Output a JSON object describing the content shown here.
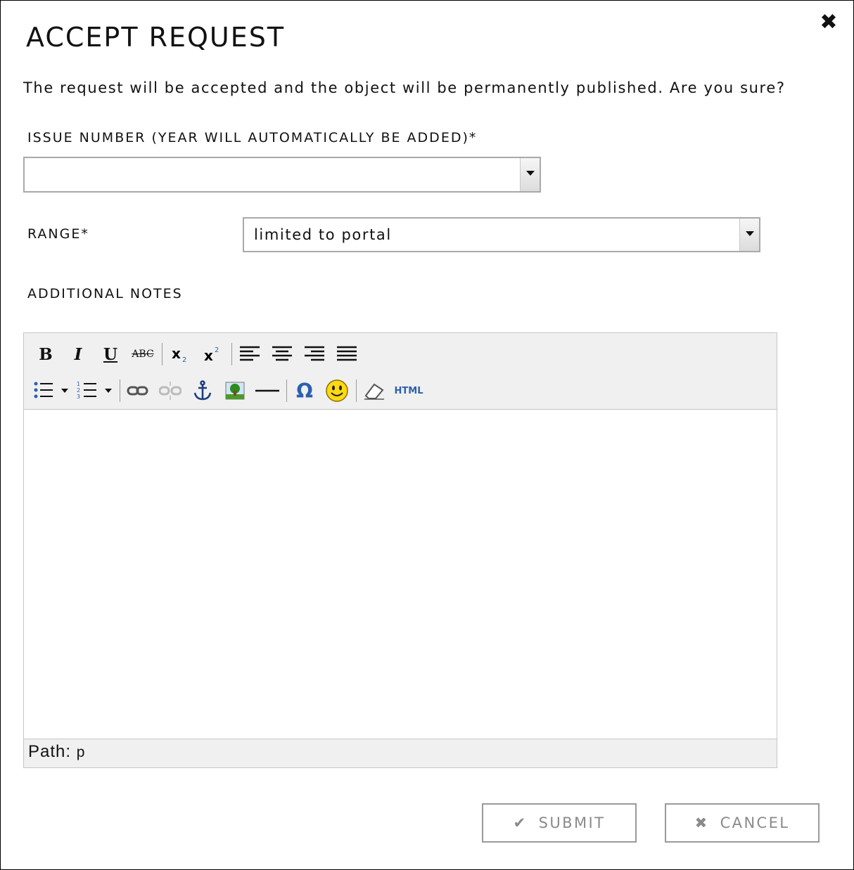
{
  "dialog": {
    "title": "ACCEPT REQUEST",
    "close_icon": "close-icon",
    "message": "The request will be accepted and the object will be permanently published. Are you sure?"
  },
  "issue_number": {
    "label": "ISSUE NUMBER (YEAR WILL AUTOMATICALLY BE ADDED)*",
    "value": ""
  },
  "range": {
    "label": "RANGE*",
    "value": "limited to portal"
  },
  "notes": {
    "label": "ADDITIONAL NOTES",
    "toolbar_row1": [
      "bold-icon",
      "italic-icon",
      "underline-icon",
      "strikethrough-icon",
      "subscript-icon",
      "superscript-icon",
      "align-left-icon",
      "align-center-icon",
      "align-right-icon",
      "align-justify-icon"
    ],
    "toolbar_row2": [
      "bullet-list-icon",
      "numbered-list-icon",
      "link-icon",
      "unlink-icon",
      "anchor-icon",
      "image-icon",
      "horizontal-rule-icon",
      "special-char-icon",
      "emoticon-icon",
      "clear-format-icon",
      "html-source-icon"
    ],
    "bold_glyph": "B",
    "italic_glyph": "I",
    "underline_glyph": "U",
    "strike_glyph": "ABC",
    "omega_glyph": "Ω",
    "html_glyph": "HTML",
    "path_label": "Path:",
    "path_value": "p"
  },
  "buttons": {
    "submit": "SUBMIT",
    "cancel": "CANCEL"
  },
  "colors": {
    "border": "#a9a9a9",
    "toolbar_bg": "#f0f0f0",
    "button_text": "#8a8a8a"
  }
}
